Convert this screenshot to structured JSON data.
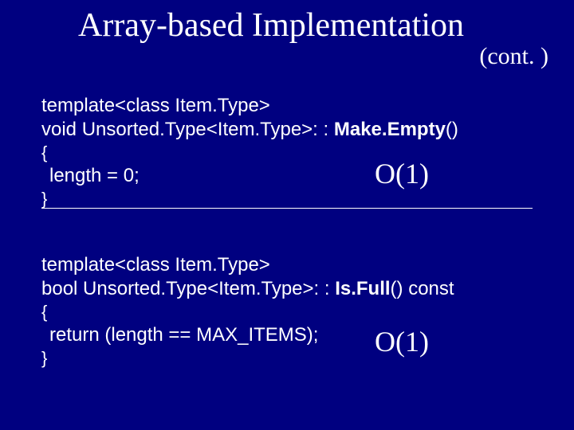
{
  "title": "Array-based Implementation",
  "cont": "(cont. )",
  "block1": {
    "l1": "template<class Item.Type>",
    "l2a": "void Unsorted.Type<Item.Type>: : ",
    "l2b": "Make.Empty",
    "l2c": "()",
    "l3": "{",
    "l4": "length = 0;",
    "l5": "}"
  },
  "block2": {
    "l1": "template<class Item.Type>",
    "l2a": "bool Unsorted.Type<Item.Type>: : ",
    "l2b": "Is.Full",
    "l2c": "() const",
    "l3": "{",
    "l4": "return (length == MAX_ITEMS);",
    "l5": "}"
  },
  "complexity1": "O(1)",
  "complexity2": "O(1)"
}
